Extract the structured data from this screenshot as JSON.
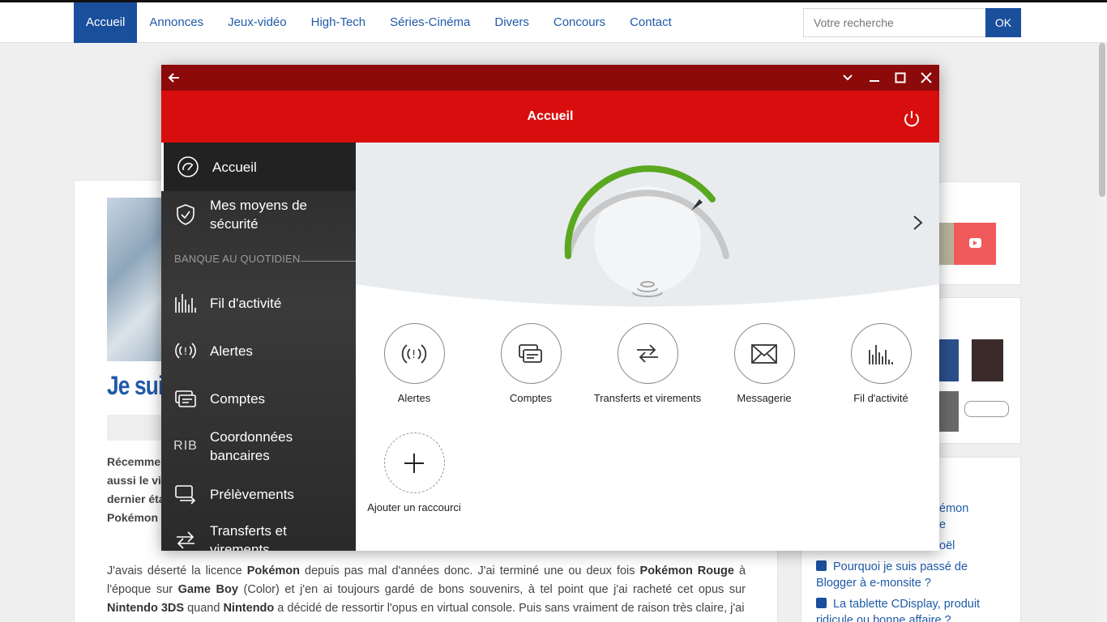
{
  "site": {
    "nav": [
      "Accueil",
      "Annonces",
      "Jeux-vidéo",
      "High-Tech",
      "Séries-Cinéma",
      "Divers",
      "Concours",
      "Contact"
    ],
    "search_placeholder": "Votre recherche",
    "search_button": "OK",
    "article_title": "Je suis",
    "intro_lines": [
      "Récemmen",
      "aussi le vi",
      "dernier éta",
      "Pokémon"
    ],
    "paragraph_html_parts": {
      "line1": "J'avais déserté la licence ",
      "b1": "Pokémon",
      "line1b": " depuis pas mal d'années donc. J'ai terminé une ou deux fois ",
      "b2": "Pokémon Rouge",
      "line1c": " à l'époque sur ",
      "b3": "Game Boy",
      "line1d": " (Color) et j'en ai toujours gardé de bons souvenirs, à tel point que j'ai racheté cet opus sur ",
      "b4": "Nintendo 3DS",
      "line1e": " quand ",
      "b5": "Nintendo",
      "line1f": " a décidé de ressortir l'opus en virtual console. Puis sans vraiment de raison très claire, j'ai"
    },
    "side_links": [
      "émon",
      "e",
      "oël",
      "Pourquoi je suis passé de Blogger à e-monsite ?",
      "La tablette CDisplay, produit ridicule ou bonne affaire ?"
    ]
  },
  "app": {
    "header_title": "Accueil",
    "sidebar": {
      "items": [
        {
          "label": "Accueil",
          "icon": "gauge-icon"
        },
        {
          "label": "Mes moyens de sécurité",
          "icon": "shield-check-icon"
        },
        {
          "label": "Fil d'activité",
          "icon": "activity-bars-icon"
        },
        {
          "label": "Alertes",
          "icon": "alert-signal-icon"
        },
        {
          "label": "Comptes",
          "icon": "cards-icon"
        },
        {
          "label": "Coordonnées bancaires",
          "icon": "rib-icon",
          "icon_text": "RIB"
        },
        {
          "label": "Prélèvements",
          "icon": "direct-debit-icon"
        },
        {
          "label": "Transferts et virements",
          "icon": "transfer-arrows-icon"
        }
      ],
      "section": "BANQUE AU QUOTIDIEN"
    },
    "shortcuts": [
      {
        "label": "Alertes",
        "icon": "alert-signal-icon"
      },
      {
        "label": "Comptes",
        "icon": "cards-icon"
      },
      {
        "label": "Transferts et virements",
        "icon": "transfer-arrows-icon"
      },
      {
        "label": "Messagerie",
        "icon": "envelope-icon"
      },
      {
        "label": "Fil d'activité",
        "icon": "activity-bars-icon"
      },
      {
        "label": "Ajouter un raccourci",
        "icon": "plus-icon"
      }
    ],
    "colors": {
      "titlebar": "#8c0a0a",
      "header": "#d80d0d",
      "gauge_green": "#5aa820"
    }
  }
}
